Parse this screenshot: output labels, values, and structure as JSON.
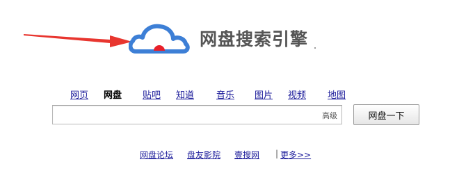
{
  "logo": {
    "text": "网盘搜索引擎",
    "cloud_color": "#3d7fd6",
    "dot_color": "#e8202a"
  },
  "annotation": {
    "arrow_color": "#e8362f"
  },
  "nav": {
    "items": [
      {
        "label": "网页",
        "current": false
      },
      {
        "label": "网盘",
        "current": true
      },
      {
        "label": "贴吧",
        "current": false
      },
      {
        "label": "知道",
        "current": false
      },
      {
        "label": "音乐",
        "current": false
      },
      {
        "label": "图片",
        "current": false
      },
      {
        "label": "视频",
        "current": false
      },
      {
        "label": "地图",
        "current": false
      }
    ]
  },
  "search": {
    "value": "",
    "advanced_label": "高级",
    "button_label": "网盘一下"
  },
  "footer": {
    "links": [
      "网盘论坛",
      "盘友影院",
      "壹搜网"
    ],
    "separator": "|",
    "more_label": "更多>>"
  }
}
